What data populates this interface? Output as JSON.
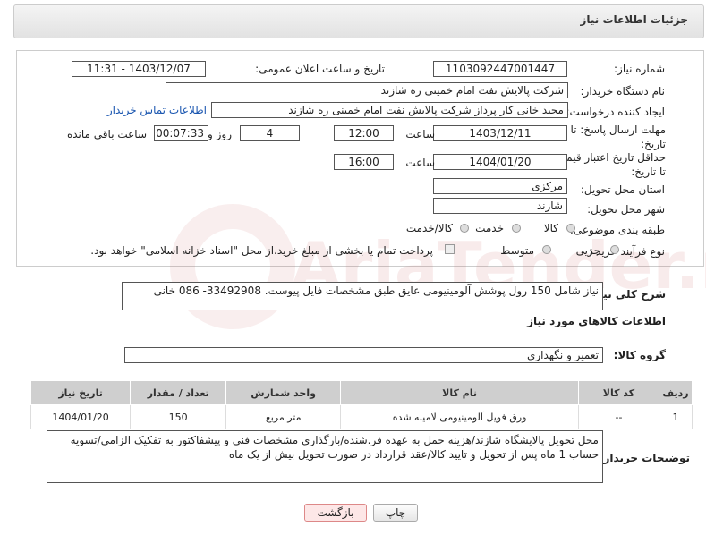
{
  "header": {
    "title": "جزئیات اطلاعات نیاز"
  },
  "form": {
    "need_number_label": "شماره نیاز:",
    "need_number": "1103092447001447",
    "announce_label": "تاریخ و ساعت اعلان عمومی:",
    "announce_value": "1403/12/07 - 11:31",
    "buyer_org_label": "نام دستگاه خریدار:",
    "buyer_org": "شرکت پالایش نفت امام خمینی  ره  شازند",
    "requester_label": "ایجاد کننده درخواست:",
    "requester": "مجید خانی کار پرداز شرکت پالایش نفت امام خمینی  ره  شازند",
    "contact_link": "اطلاعات تماس خریدار",
    "deadline_label": "مهلت ارسال پاسخ: تا تاریخ:",
    "deadline_date": "1403/12/11",
    "time_label": "ساعت",
    "deadline_time": "12:00",
    "days": "4",
    "days_label": "روز و",
    "remaining": "00:07:33",
    "remaining_label": "ساعت باقی مانده",
    "price_label": "حداقل تاریخ اعتبار قیمت: تا تاریخ:",
    "price_date": "1404/01/20",
    "price_time": "16:00",
    "province_label": "استان محل تحویل:",
    "province": "مرکزی",
    "city_label": "شهر محل تحویل:",
    "city": "شازند",
    "category_label": "طبقه بندی موضوعی:",
    "category_options": [
      "کالا",
      "خدمت",
      "کالا/خدمت"
    ],
    "process_label": "نوع فرآیند خرید :",
    "process_options": [
      "جزیی",
      "متوسط"
    ],
    "payment_note": "پرداخت تمام یا بخشی از مبلغ خرید،از محل \"اسناد خزانه اسلامی\" خواهد بود."
  },
  "description": {
    "label": "شرح کلی نیاز:",
    "text": "نیاز شامل 150 رول پوشش آلومینیومی عایق طبق مشخصات فایل پیوست. 33492908- 086 خانی"
  },
  "goods": {
    "section_title": "اطلاعات کالاهای مورد نیاز",
    "group_label": "گروه کالا:",
    "group_value": "تعمیر و نگهداری",
    "columns": [
      "ردیف",
      "کد کالا",
      "نام کالا",
      "واحد شمارش",
      "تعداد / مقدار",
      "تاریخ نیاز"
    ],
    "rows": [
      {
        "row": "1",
        "code": "--",
        "name": "ورق فویل آلومینیومی لامینه شده",
        "unit": "متر مربع",
        "qty": "150",
        "date": "1404/01/20"
      }
    ]
  },
  "buyer_notes": {
    "label": "توضیحات خریدار:",
    "text": "محل تحویل پالایشگاه شازند/هزینه حمل به عهده فر.شنده/بارگذاری مشخصات فنی و پیشفاکتور به تفکیک الزامی/تسویه حساب 1 ماه پس از تحویل و تایید کالا/عقد قرارداد در صورت تحویل بیش از یک ماه"
  },
  "buttons": {
    "print": "چاپ",
    "back": "بازگشت"
  },
  "watermark": "AriaTender.neT",
  "colors": {
    "link": "#1a56b0",
    "table_header": "#cfcfcf",
    "back_button": "#fde7e7"
  }
}
